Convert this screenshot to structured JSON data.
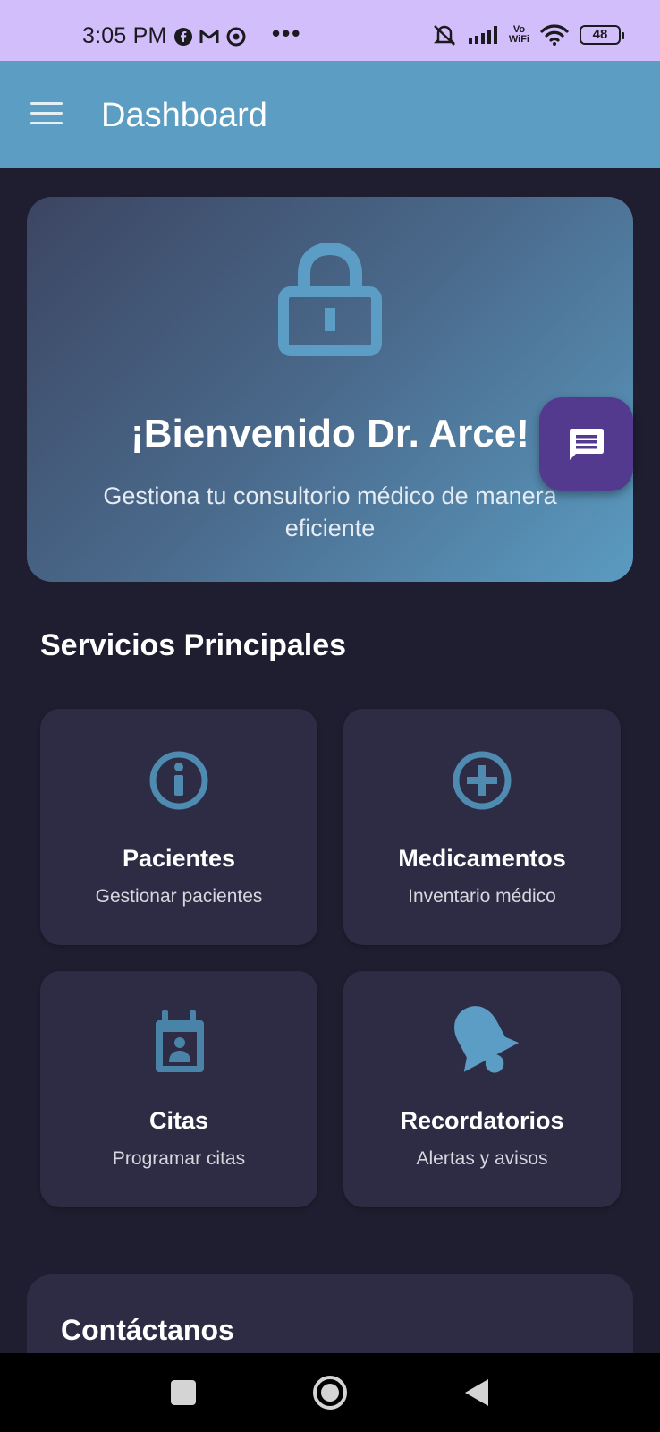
{
  "status_bar": {
    "time": "3:05 PM",
    "dots": "•••",
    "vowifi_top": "Vo",
    "vowifi_bottom": "WiFi",
    "battery": "48",
    "icons": [
      "facebook-icon",
      "gmail-icon",
      "app-icon",
      "mute-icon",
      "signal-icon",
      "vowifi-icon",
      "wifi-icon",
      "battery-icon"
    ]
  },
  "app_bar": {
    "title": "Dashboard",
    "menu_icon": "menu-icon"
  },
  "hero": {
    "icon": "lock-icon",
    "title": "¡Bienvenido Dr. Arce!",
    "subtitle": "Gestiona tu consultorio médico de manera eficiente"
  },
  "fab": {
    "icon": "chat-icon"
  },
  "services": {
    "section_title": "Servicios Principales",
    "items": [
      {
        "title": "Pacientes",
        "subtitle": "Gestionar pacientes",
        "icon": "info-icon"
      },
      {
        "title": "Medicamentos",
        "subtitle": "Inventario médico",
        "icon": "add-circle-icon"
      },
      {
        "title": "Citas",
        "subtitle": "Programar citas",
        "icon": "calendar-person-icon"
      },
      {
        "title": "Recordatorios",
        "subtitle": "Alertas y avisos",
        "icon": "bell-icon"
      }
    ]
  },
  "contact": {
    "title": "Contáctanos"
  },
  "colors": {
    "status_bar": "#d2befb",
    "app_bar": "#5c9ec3",
    "background": "#1f1e30",
    "card": "#2d2c44",
    "fab": "#543a8e",
    "icon_accent": "#5b9dc4"
  }
}
